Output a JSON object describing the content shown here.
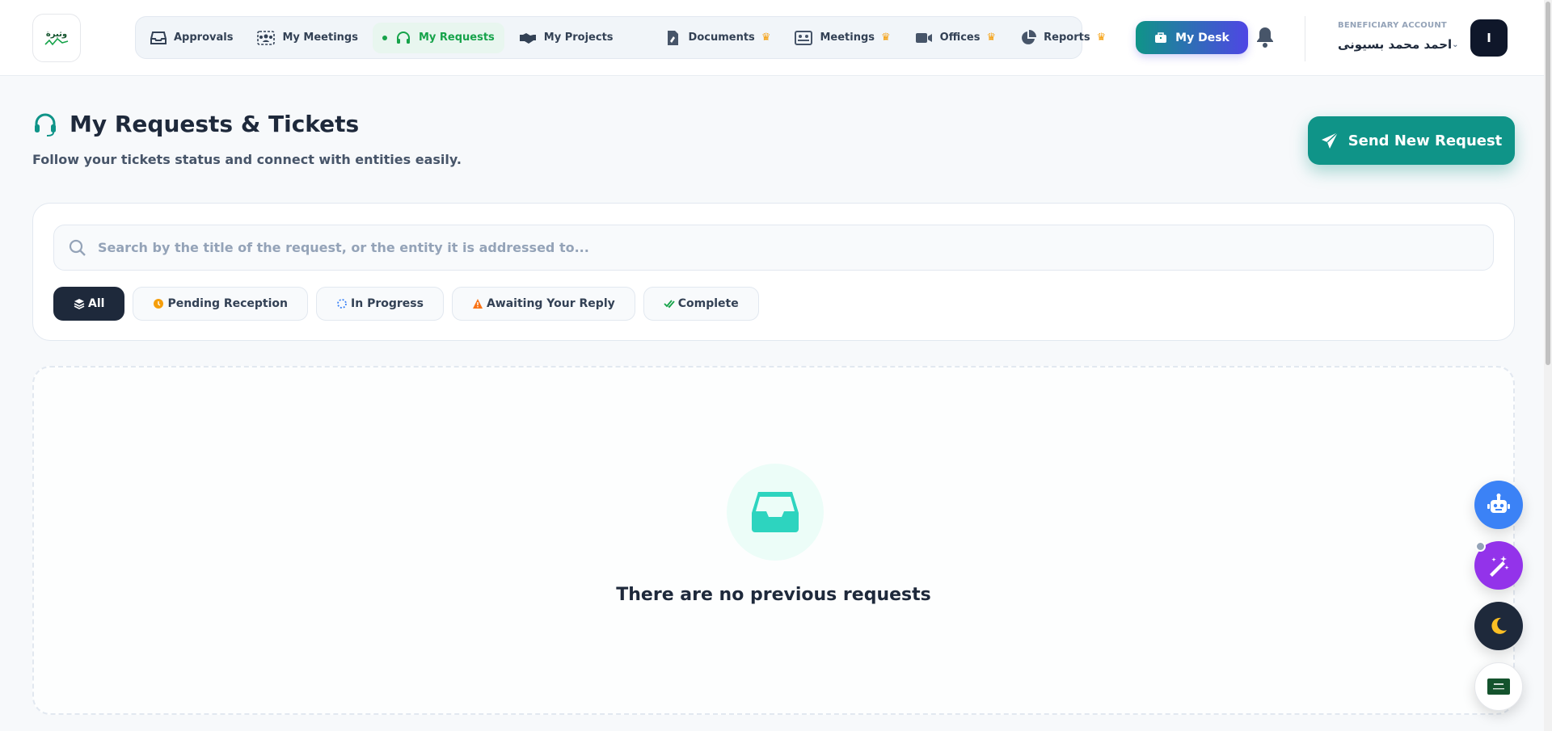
{
  "brand": {
    "logo_text": "وثيرة"
  },
  "nav": {
    "items": [
      {
        "label": "Approvals",
        "icon": "inbox-icon"
      },
      {
        "label": "My Meetings",
        "icon": "users-icon"
      },
      {
        "label": "My Requests",
        "icon": "headset-icon",
        "active": true
      },
      {
        "label": "My Projects",
        "icon": "handshake-icon"
      },
      {
        "label": "Documents",
        "icon": "file-signature-icon",
        "premium": true
      },
      {
        "label": "Meetings",
        "icon": "meeting-board-icon",
        "premium": true
      },
      {
        "label": "Offices",
        "icon": "video-icon",
        "premium": true
      },
      {
        "label": "Reports",
        "icon": "pie-chart-icon",
        "premium": true
      }
    ],
    "crown": "♛"
  },
  "header": {
    "desk_label": "My Desk",
    "account_label": "BENEFICIARY ACCOUNT",
    "account_name": "احمد محمد بسيونى",
    "avatar_initial": "I"
  },
  "page": {
    "title": "My Requests & Tickets",
    "subtitle": "Follow your tickets status and connect with entities easily.",
    "send_label": "Send New Request"
  },
  "search": {
    "placeholder": "Search by the title of the request, or the entity it is addressed to..."
  },
  "filters": [
    {
      "label": "All",
      "active": true
    },
    {
      "label": "Pending Reception"
    },
    {
      "label": "In Progress"
    },
    {
      "label": "Awaiting Your Reply"
    },
    {
      "label": "Complete"
    }
  ],
  "empty_state": {
    "message": "There are no previous requests"
  },
  "colors": {
    "accent": "#0f9488",
    "active_nav": "#16a34a",
    "premium": "#f59e0b",
    "dark": "#1e293b"
  }
}
